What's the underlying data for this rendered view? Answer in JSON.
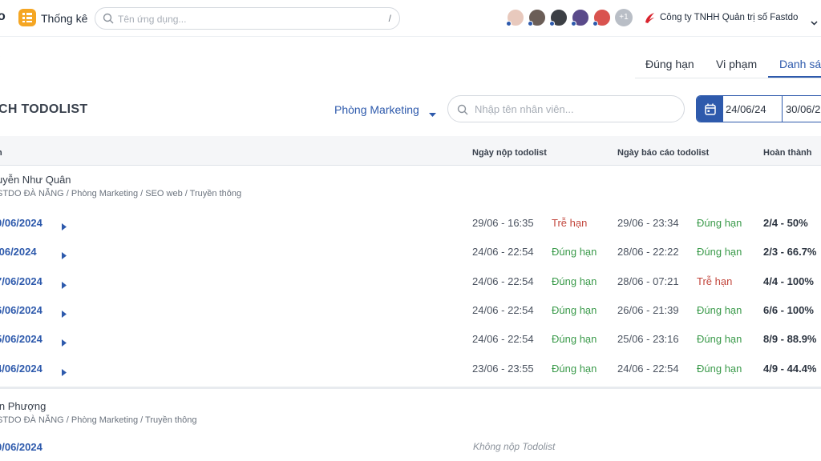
{
  "topbar": {
    "logo_fragment": "o",
    "app_title": "Thống kê",
    "search_placeholder": "Tên ứng dụng...",
    "search_shortcut": "/",
    "avatars": [
      {
        "color": "#e8c9bd"
      },
      {
        "color": "#6b5e57"
      },
      {
        "color": "#3c3f45"
      },
      {
        "color": "#5a4a8a"
      },
      {
        "color": "#d9534f"
      }
    ],
    "more_count": "+1",
    "company": "Công ty TNHH Quản trị số Fastdo"
  },
  "tabs": [
    "Đúng hạn",
    "Vi phạm",
    "Danh sá"
  ],
  "list": {
    "title": "CH TODOLIST",
    "department": "Phòng Marketing",
    "employee_search_placeholder": "Nhập tên nhân viên...",
    "date_from": "24/06/24",
    "date_to": "30/06/2"
  },
  "table": {
    "columns": [
      "n",
      "Ngày nộp todolist",
      "Ngày báo cáo todolist",
      "Hoàn thành"
    ],
    "groups": [
      {
        "name": "uyễn Như Quân",
        "path": "STDO ĐÀ NẴNG / Phòng Marketing / SEO web / Truyền thông",
        "rows": [
          {
            "date": "0/06/2024",
            "submit_time": "29/06 - 16:35",
            "submit_status": "Trễ hạn",
            "report_time": "29/06 - 23:34",
            "report_status": "Đúng hạn",
            "done": "2/4 - 50%"
          },
          {
            "date": "/06/2024",
            "submit_time": "24/06 - 22:54",
            "submit_status": "Đúng hạn",
            "report_time": "28/06 - 22:22",
            "report_status": "Đúng hạn",
            "done": "2/3 - 66.7%"
          },
          {
            "date": "7/06/2024",
            "submit_time": "24/06 - 22:54",
            "submit_status": "Đúng hạn",
            "report_time": "28/06 - 07:21",
            "report_status": "Trễ hạn",
            "done": "4/4 - 100%"
          },
          {
            "date": "6/06/2024",
            "submit_time": "24/06 - 22:54",
            "submit_status": "Đúng hạn",
            "report_time": "26/06 - 21:39",
            "report_status": "Đúng hạn",
            "done": "6/6 - 100%"
          },
          {
            "date": "5/06/2024",
            "submit_time": "24/06 - 22:54",
            "submit_status": "Đúng hạn",
            "report_time": "25/06 - 23:16",
            "report_status": "Đúng hạn",
            "done": "8/9 - 88.9%"
          },
          {
            "date": "4/06/2024",
            "submit_time": "23/06 - 23:55",
            "submit_status": "Đúng hạn",
            "report_time": "24/06 - 22:54",
            "report_status": "Đúng hạn",
            "done": "4/9 - 44.4%"
          }
        ]
      },
      {
        "name": "in Phượng",
        "path": "STDO ĐÀ NẴNG / Phòng Marketing / Truyền thông",
        "rows": [
          {
            "date": "0/06/2024",
            "note": "Không nộp Todolist"
          }
        ]
      }
    ]
  }
}
